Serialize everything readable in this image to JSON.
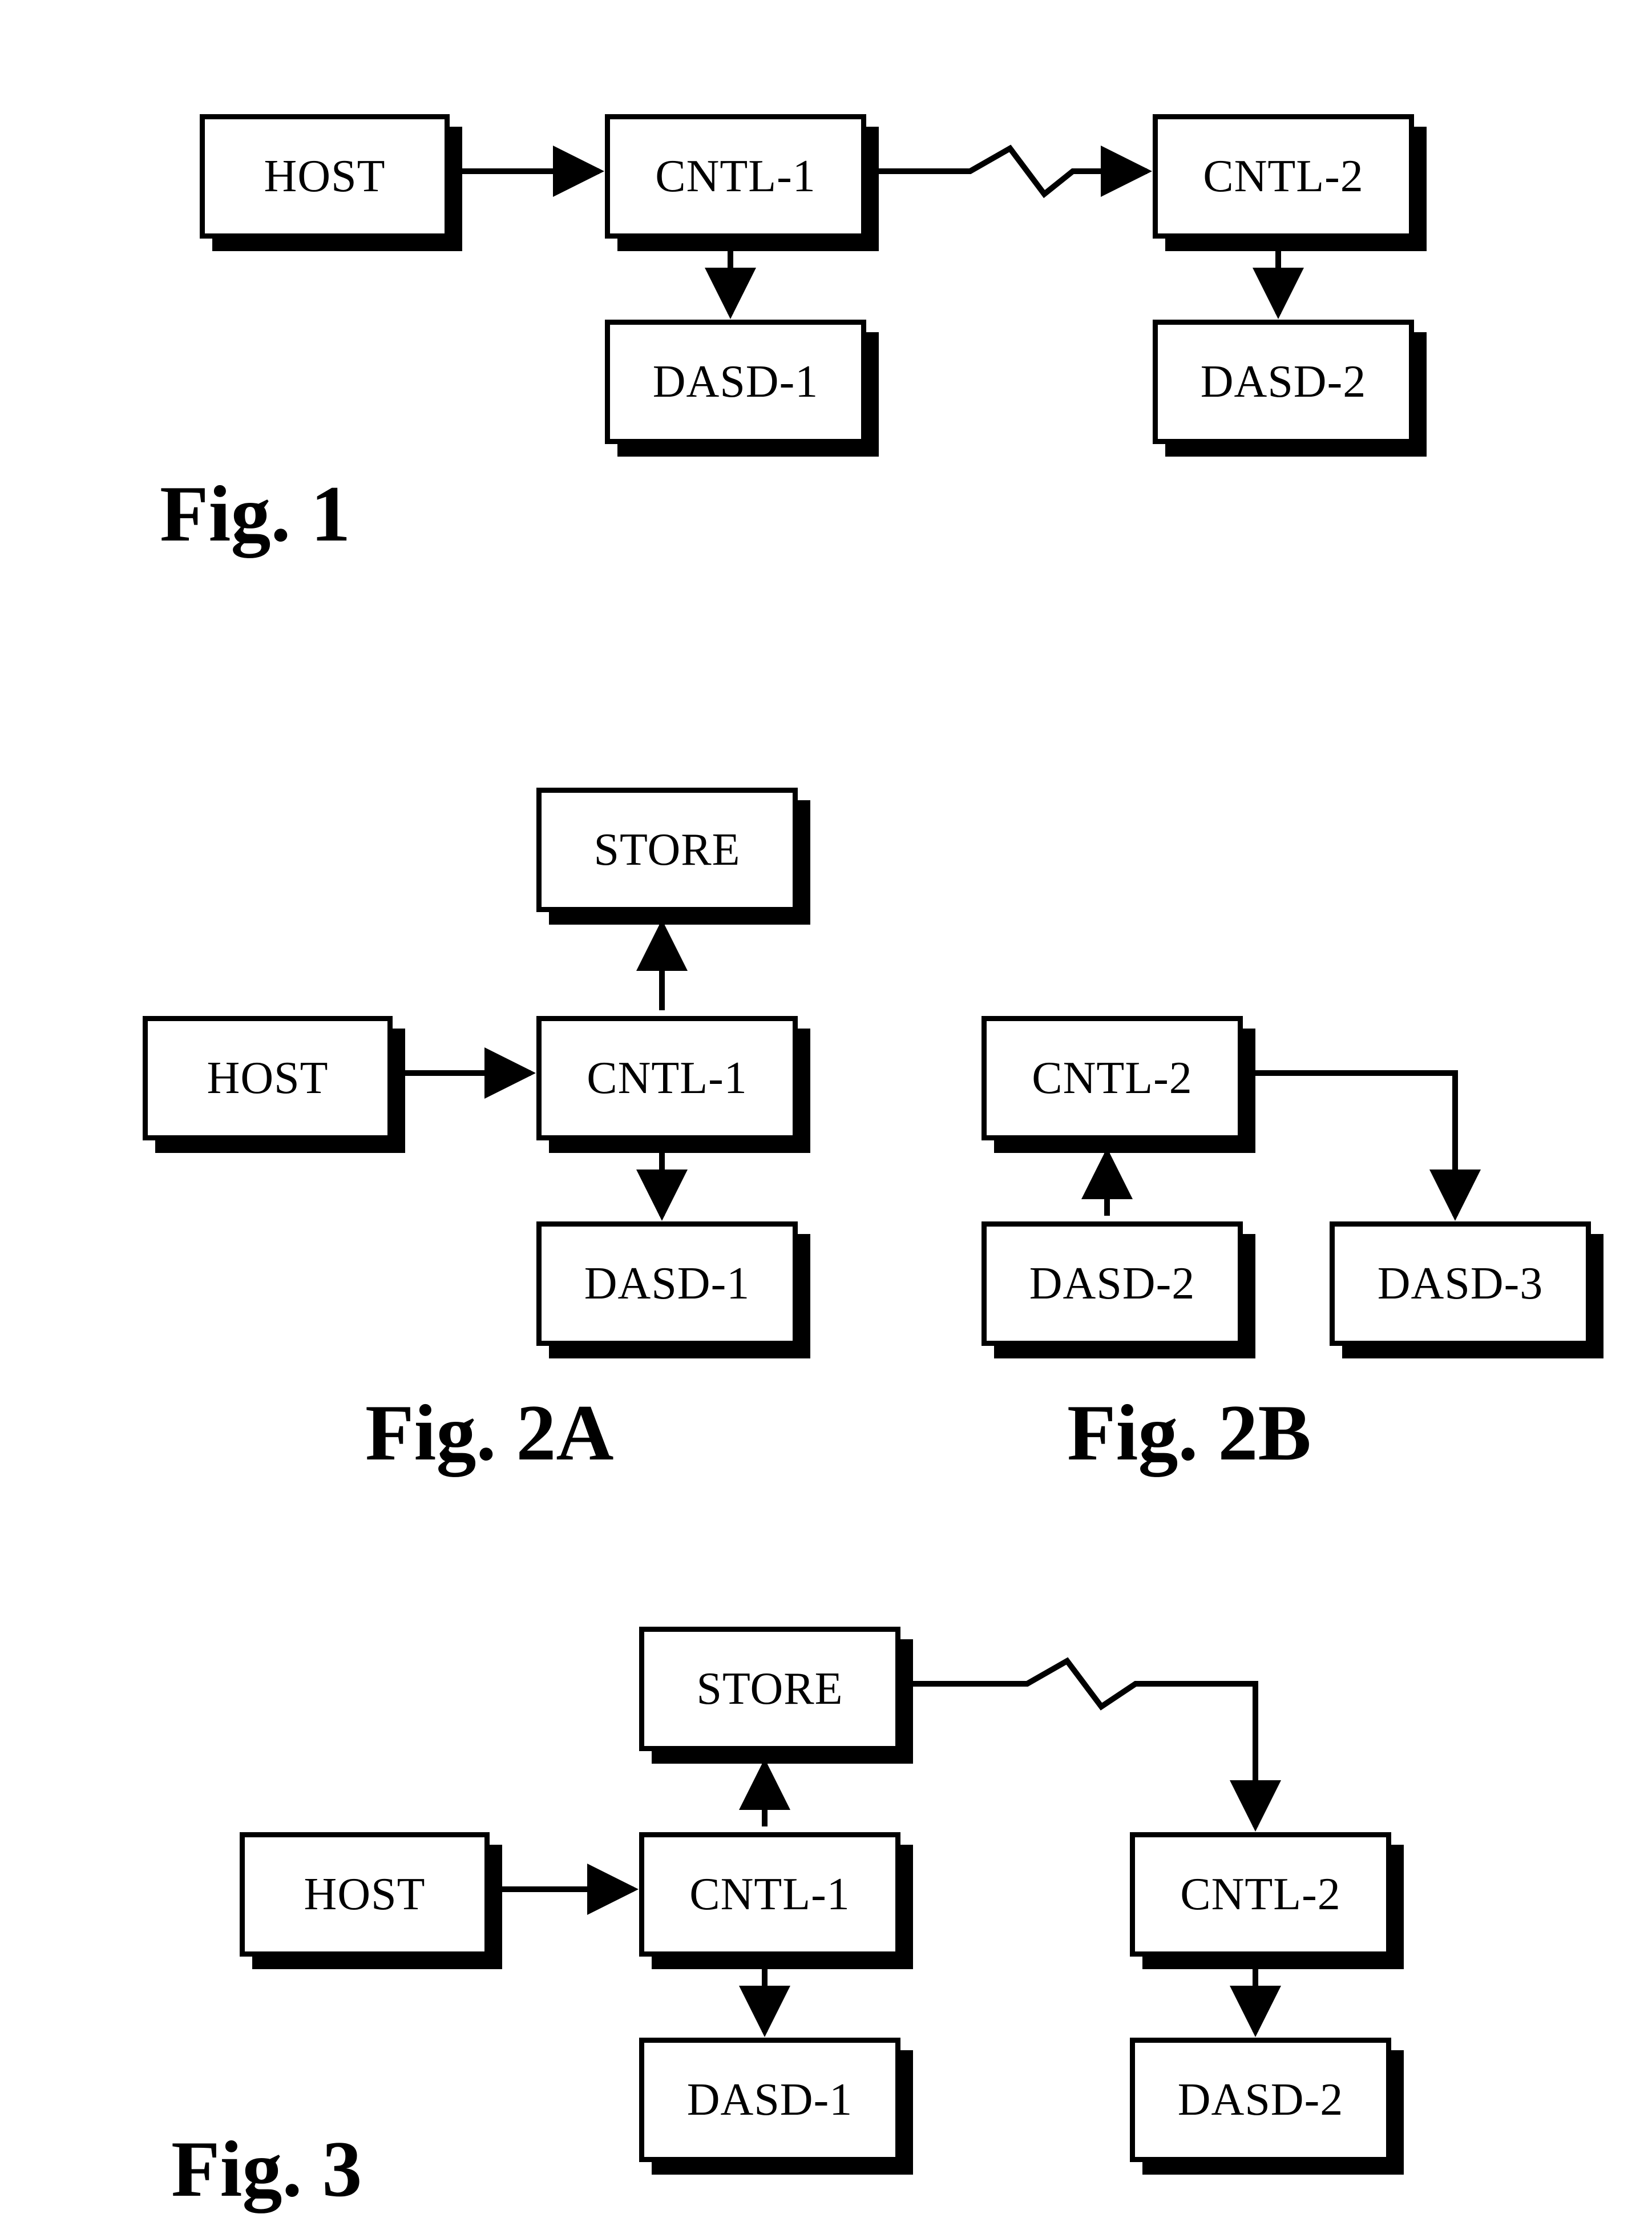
{
  "fig1": {
    "label": "Fig. 1",
    "host": "HOST",
    "cntl1": "CNTL-1",
    "cntl2": "CNTL-2",
    "dasd1": "DASD-1",
    "dasd2": "DASD-2"
  },
  "fig2a": {
    "label": "Fig. 2A",
    "host": "HOST",
    "store": "STORE",
    "cntl1": "CNTL-1",
    "dasd1": "DASD-1"
  },
  "fig2b": {
    "label": "Fig. 2B",
    "cntl2": "CNTL-2",
    "dasd2": "DASD-2",
    "dasd3": "DASD-3"
  },
  "fig3": {
    "label": "Fig. 3",
    "host": "HOST",
    "store": "STORE",
    "cntl1": "CNTL-1",
    "cntl2": "CNTL-2",
    "dasd1": "DASD-1",
    "dasd2": "DASD-2"
  },
  "chart_data": [
    {
      "type": "diagram",
      "name": "Fig. 1",
      "nodes": [
        "HOST",
        "CNTL-1",
        "CNTL-2",
        "DASD-1",
        "DASD-2"
      ],
      "edges": [
        {
          "from": "HOST",
          "to": "CNTL-1",
          "style": "arrow"
        },
        {
          "from": "CNTL-1",
          "to": "CNTL-2",
          "style": "zigzag-arrow"
        },
        {
          "from": "CNTL-1",
          "to": "DASD-1",
          "style": "arrow"
        },
        {
          "from": "CNTL-2",
          "to": "DASD-2",
          "style": "arrow"
        }
      ]
    },
    {
      "type": "diagram",
      "name": "Fig. 2A",
      "nodes": [
        "HOST",
        "STORE",
        "CNTL-1",
        "DASD-1"
      ],
      "edges": [
        {
          "from": "HOST",
          "to": "CNTL-1",
          "style": "arrow"
        },
        {
          "from": "CNTL-1",
          "to": "STORE",
          "style": "arrow"
        },
        {
          "from": "CNTL-1",
          "to": "DASD-1",
          "style": "arrow"
        }
      ]
    },
    {
      "type": "diagram",
      "name": "Fig. 2B",
      "nodes": [
        "CNTL-2",
        "DASD-2",
        "DASD-3"
      ],
      "edges": [
        {
          "from": "DASD-2",
          "to": "CNTL-2",
          "style": "arrow"
        },
        {
          "from": "CNTL-2",
          "to": "DASD-3",
          "style": "elbow-arrow"
        }
      ]
    },
    {
      "type": "diagram",
      "name": "Fig. 3",
      "nodes": [
        "HOST",
        "STORE",
        "CNTL-1",
        "CNTL-2",
        "DASD-1",
        "DASD-2"
      ],
      "edges": [
        {
          "from": "HOST",
          "to": "CNTL-1",
          "style": "arrow"
        },
        {
          "from": "CNTL-1",
          "to": "STORE",
          "style": "arrow"
        },
        {
          "from": "STORE",
          "to": "CNTL-2",
          "style": "zigzag-elbow-arrow"
        },
        {
          "from": "CNTL-1",
          "to": "DASD-1",
          "style": "arrow"
        },
        {
          "from": "CNTL-2",
          "to": "DASD-2",
          "style": "arrow"
        }
      ]
    }
  ]
}
